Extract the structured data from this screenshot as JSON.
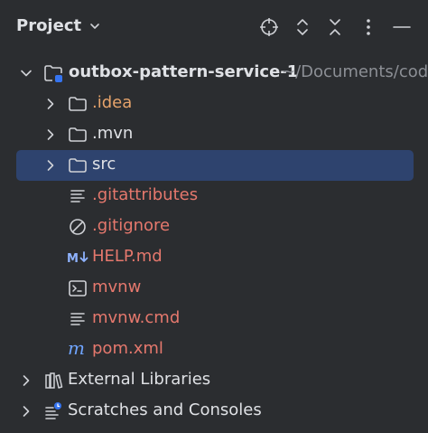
{
  "header": {
    "title": "Project"
  },
  "tree": {
    "root": {
      "label": "outbox-pattern-service-1",
      "path": "~/Documents/code"
    },
    "items": [
      {
        "label": ".idea"
      },
      {
        "label": ".mvn"
      },
      {
        "label": "src"
      },
      {
        "label": ".gitattributes"
      },
      {
        "label": ".gitignore"
      },
      {
        "label": "HELP.md"
      },
      {
        "label": "mvnw"
      },
      {
        "label": "mvnw.cmd"
      },
      {
        "label": "pom.xml"
      }
    ],
    "external_libraries": "External Libraries",
    "scratches": "Scratches and Consoles"
  },
  "colors": {
    "background": "#2b2d30",
    "selection": "#2e436e",
    "text": "#dfe1e5",
    "modified_orange": "#e6a36b",
    "untracked_red": "#e5786d",
    "muted": "#8c8f95",
    "maven_blue": "#6fa4ff"
  },
  "icons": {
    "header": [
      "locate-icon",
      "expand-all-icon",
      "collapse-all-icon",
      "more-options-icon",
      "minimize-icon"
    ]
  }
}
